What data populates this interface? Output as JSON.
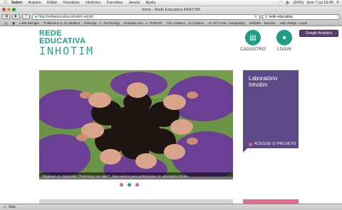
{
  "menubar": {
    "apple": "",
    "items": [
      "Safari",
      "Arquivo",
      "Editar",
      "Visualizar",
      "Histórico",
      "Favoritos",
      "Janela",
      "Ajuda"
    ],
    "battery": "(64%)",
    "clock": "dom 7 jul  19:40"
  },
  "window": {
    "title": "Início - Rede Educativa INHOTIM"
  },
  "toolbar": {
    "back": "◀",
    "forward": "▶",
    "url": "http://redeeducativa.inhotim.org.br/",
    "search_value": "rede educativa"
  },
  "bookmarks": [
    "Lotte Reiniger",
    "Politecnico d...la didattica",
    "EdSurge : Y...Technology",
    "Entenda com...s : PORVIR",
    "The Creators ...ct | Vídeos",
    "AI~AP | Ame...hotography",
    "Dribbble - Buckets",
    "voltz design : Login"
  ],
  "site": {
    "logo_line1": "REDE",
    "logo_line2": "EDUCATIVA",
    "logo_line3": "INHOTIM",
    "cadastro": "CADASTRO",
    "login": "LOGIN",
    "google_analytics": "Google Analytics",
    "hero_caption": "Fragmento do Stopmotion \"Preferimos nos calar?\", desenvolvido pelos participantes do Laboratório Inhotim.",
    "side_title_1": "Laboratório",
    "side_title_2": "Inhotim",
    "side_link": "ACESSE O PROJETO",
    "slides_total": 3,
    "slide_active": 2
  },
  "status": {
    "text": "Sala"
  },
  "colors": {
    "teal": "#1f9d86",
    "purple": "#5c4a86",
    "pink": "#e65c8c"
  }
}
